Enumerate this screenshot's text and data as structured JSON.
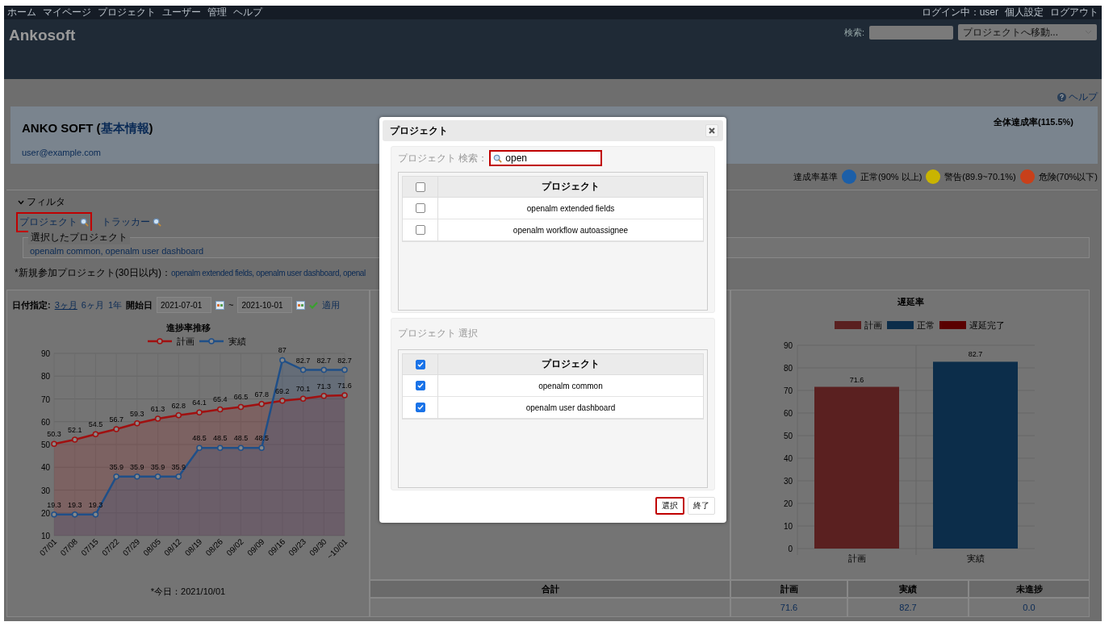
{
  "top_nav": {
    "items": [
      "ホーム",
      "マイページ",
      "プロジェクト",
      "ユーザー",
      "管理",
      "ヘルプ"
    ],
    "user": "ログイン中：user",
    "links": [
      "個人設定",
      "ログアウト"
    ]
  },
  "header": {
    "logo": "Ankosoft",
    "search_label": "検索:",
    "project_jump": "プロジェクトへ移動..."
  },
  "help_link": "ヘルプ",
  "info": {
    "name_prefix": "ANKO SOFT (",
    "name_link": "基本情報",
    "name_suffix": ")",
    "email": "user@example.com",
    "overall": "全体達成率(115.5%)"
  },
  "criteria": {
    "label": "達成率基準",
    "levels": [
      {
        "label": "正常(90% 以上)",
        "color": "#1c5fa8"
      },
      {
        "label": "警告(89.9~70.1%)",
        "color": "#c9b400"
      },
      {
        "label": "危険(70%以下)",
        "color": "#c8401a"
      }
    ]
  },
  "filter": {
    "label": "フィルタ",
    "expanded": true,
    "links": [
      {
        "label": "プロジェクト",
        "highlighted": true
      },
      {
        "label": "トラッカー",
        "highlighted": false
      }
    ],
    "selected_legend": "選択したプロジェクト",
    "selected_projects": "openalm common, openalm user dashboard",
    "new_label": "*新規参加プロジェクト(30日以内)：",
    "new_projects": "openalm extended fields, openalm user dashboard, openal"
  },
  "date_range": {
    "label": "日付指定:",
    "presets": [
      {
        "label": "3ヶ月",
        "selected": true
      },
      {
        "label": "6ヶ月",
        "selected": false
      },
      {
        "label": "1年",
        "selected": false
      }
    ],
    "start_label": "開始日",
    "from": "2021-07-01",
    "separator": "~",
    "to": "2021-10-01",
    "apply": "適用"
  },
  "progress_chart": {
    "chart_data": {
      "type": "area",
      "legend": true,
      "grid": true,
      "title": "進捗率推移",
      "categories": [
        "07/01",
        "07/08",
        "07/15",
        "07/22",
        "07/29",
        "08/05",
        "08/12",
        "08/19",
        "08/26",
        "09/02",
        "09/09",
        "09/16",
        "09/23",
        "09/30",
        "~10/01"
      ],
      "series": [
        {
          "name": "計画",
          "color": "#a01010",
          "marker": "circle",
          "values": [
            50.3,
            52.1,
            54.5,
            56.7,
            59.3,
            61.3,
            62.8,
            64.1,
            65.4,
            66.5,
            67.8,
            69.2,
            70.1,
            71.3,
            71.6
          ]
        },
        {
          "name": "実績",
          "color": "#1f4f88",
          "marker": "circle",
          "values": [
            19.3,
            19.3,
            19.3,
            35.9,
            35.9,
            35.9,
            35.9,
            48.5,
            48.5,
            48.5,
            48.5,
            87,
            82.7,
            82.7,
            82.7
          ]
        }
      ],
      "ylim": [
        10,
        90
      ],
      "yticks": [
        10,
        20,
        30,
        40,
        50,
        60,
        70,
        80,
        90
      ],
      "data_labels": true
    },
    "footnote": "*今日：2021/10/01"
  },
  "delay_chart": {
    "chart_data": {
      "type": "bar",
      "legend": true,
      "grid": true,
      "title": "遅延率",
      "categories": [
        "計画",
        "実績"
      ],
      "series": [
        {
          "name": "計画",
          "color": "#5a2020",
          "values": [
            71.6,
            null
          ]
        },
        {
          "name": "正常",
          "color": "#0c2d4a",
          "values": [
            null,
            82.7
          ]
        },
        {
          "name": "遅延完了",
          "color": "#5a0000",
          "values": [
            null,
            null
          ]
        }
      ],
      "ylim": [
        0,
        90
      ],
      "yticks": [
        0,
        10,
        20,
        30,
        40,
        50,
        60,
        70,
        80,
        90
      ],
      "data_labels": true
    }
  },
  "summary_table": {
    "columns": [
      "合計",
      "計画",
      "実績",
      "未進捗"
    ],
    "values": [
      "71.6",
      "82.7",
      "0.0"
    ]
  },
  "dialog": {
    "title": "プロジェクト",
    "search": {
      "label": "プロジェクト 検索：",
      "value": "open",
      "highlighted": true
    },
    "results": {
      "column": "プロジェクト",
      "all_checked": false,
      "rows": [
        {
          "name": "openalm extended fields",
          "checked": false
        },
        {
          "name": "openalm workflow autoassignee",
          "checked": false
        }
      ]
    },
    "selection": {
      "title": "プロジェクト 選択",
      "column": "プロジェクト",
      "all_checked": true,
      "rows": [
        {
          "name": "openalm common",
          "checked": true
        },
        {
          "name": "openalm user dashboard",
          "checked": true
        }
      ]
    },
    "buttons": [
      {
        "label": "選択",
        "highlighted": true
      },
      {
        "label": "終了",
        "highlighted": false
      }
    ]
  }
}
